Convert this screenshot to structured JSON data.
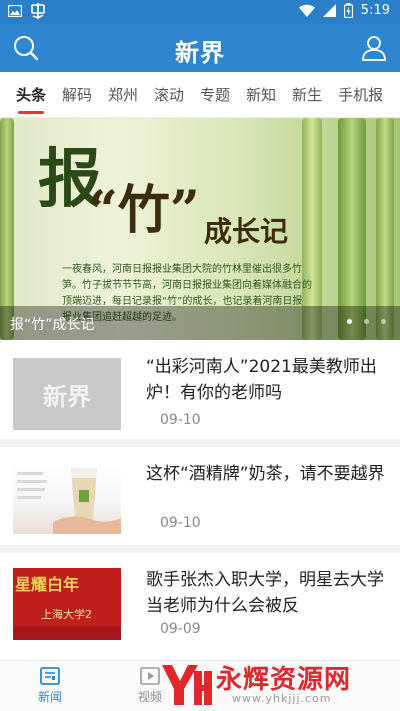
{
  "status_bar": {
    "time": "5:19"
  },
  "header": {
    "logo": "新界"
  },
  "tabs": [
    "头条",
    "解码",
    "郑州",
    "滚动",
    "专题",
    "新知",
    "新生",
    "手机报"
  ],
  "banner": {
    "title_1": "报",
    "title_2": "“竹”",
    "title_3": "成长记",
    "body": "一夜春风，河南日报报业集团大院的竹林里催出很多竹笋。竹子拔节节节高，河南日报报业集团向着媒体融合的顶端迈进，每日记录报“竹”的成长，也记录着河南日报报业集团追赶超越的足迹。",
    "caption": "报“竹”成长记",
    "slide_count": 3,
    "active_slide": 1
  },
  "news": [
    {
      "title": "“出彩河南人”2021最美教师出炉！有你的老师吗",
      "date": "09-10",
      "thumb_text": "新界"
    },
    {
      "title": "这杯“酒精牌”奶茶，请不要越界",
      "date": "09-10"
    },
    {
      "title": "歌手张杰入职大学，明星去大学当老师为什么会被反",
      "date": "09-09",
      "thumb_text": "星耀白年 上海大学"
    }
  ],
  "bottom_nav": [
    {
      "label": "新闻",
      "icon": "news-icon"
    },
    {
      "label": "视频",
      "icon": "video-icon"
    }
  ],
  "watermark": {
    "text": "永辉资源网",
    "url": "www.yhkjjj.com"
  },
  "colors": {
    "header": "#2e86d1",
    "status_bar": "#2a7fc8",
    "tab_indicator": "#e23b2e",
    "nav_active": "#2e86d1",
    "watermark": "#e0282a"
  }
}
